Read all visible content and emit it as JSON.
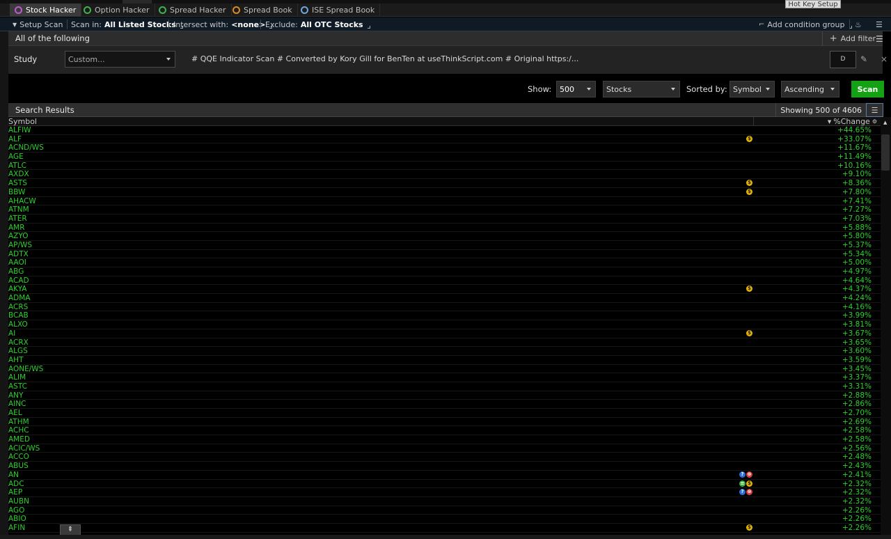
{
  "tabs": [
    {
      "label": "Stock Hacker",
      "icon": "stock-hacker-icon",
      "color": "#c05ad0",
      "active": true
    },
    {
      "label": "Option Hacker",
      "icon": "option-hacker-icon",
      "color": "#3fb34f"
    },
    {
      "label": "Spread Hacker",
      "icon": "spread-hacker-icon",
      "color": "#3fb34f"
    },
    {
      "label": "Spread Book",
      "icon": "spread-book-icon",
      "color": "#d98b25"
    },
    {
      "label": "ISE Spread Book",
      "icon": "ise-book-icon",
      "color": "#6fa6e0"
    }
  ],
  "hotkey_tooltip": "Hot Key Setup",
  "setup": {
    "setup_scan": "Setup Scan",
    "scan_in_label": "Scan in:",
    "scan_in_value": "All Listed Stocks",
    "intersect_label": "Intersect with:",
    "intersect_value": "<none>",
    "exclude_label": "Exclude:",
    "exclude_value": "All OTC Stocks",
    "add_condition_group": "Add condition group"
  },
  "filter": {
    "all_of_following": "All of the following",
    "add_filter": "Add filter"
  },
  "study": {
    "label": "Study",
    "select_value": "Custom...",
    "formula": "# QQE Indicator Scan # Converted by Kory Gill for BenTen at useThinkScript.com # Original https:/...",
    "aggregation": "D"
  },
  "controls": {
    "show_label": "Show:",
    "show_value": "500",
    "type_value": "Stocks",
    "sorted_by_label": "Sorted by:",
    "sort_field": "Symbol",
    "sort_order": "Ascending",
    "scan_button": "Scan"
  },
  "results": {
    "title": "Search Results",
    "showing": "Showing 500 of 4606",
    "col_symbol": "Symbol",
    "col_change": "%Change"
  },
  "rows": [
    {
      "symbol": "ALFIW",
      "change": "+44.65%",
      "icons": []
    },
    {
      "symbol": "ALF",
      "change": "+33.07%",
      "icons": [
        "earn"
      ]
    },
    {
      "symbol": "ACND/WS",
      "change": "+11.67%",
      "icons": []
    },
    {
      "symbol": "AGE",
      "change": "+11.49%",
      "icons": []
    },
    {
      "symbol": "ATLC",
      "change": "+10.16%",
      "icons": []
    },
    {
      "symbol": "AXDX",
      "change": "+9.10%",
      "icons": []
    },
    {
      "symbol": "ASTS",
      "change": "+8.36%",
      "icons": [
        "earn"
      ]
    },
    {
      "symbol": "BBW",
      "change": "+7.80%",
      "icons": [
        "earn"
      ]
    },
    {
      "symbol": "AHACW",
      "change": "+7.41%",
      "icons": []
    },
    {
      "symbol": "ATNM",
      "change": "+7.27%",
      "icons": []
    },
    {
      "symbol": "ATER",
      "change": "+7.03%",
      "icons": []
    },
    {
      "symbol": "AMR",
      "change": "+5.88%",
      "icons": []
    },
    {
      "symbol": "AZYO",
      "change": "+5.80%",
      "icons": []
    },
    {
      "symbol": "AP/WS",
      "change": "+5.37%",
      "icons": []
    },
    {
      "symbol": "ADTX",
      "change": "+5.34%",
      "icons": []
    },
    {
      "symbol": "AAOI",
      "change": "+5.00%",
      "icons": []
    },
    {
      "symbol": "ABG",
      "change": "+4.97%",
      "icons": []
    },
    {
      "symbol": "ACAD",
      "change": "+4.64%",
      "icons": []
    },
    {
      "symbol": "AKYA",
      "change": "+4.37%",
      "icons": [
        "earn"
      ]
    },
    {
      "symbol": "ADMA",
      "change": "+4.24%",
      "icons": []
    },
    {
      "symbol": "ACRS",
      "change": "+4.16%",
      "icons": []
    },
    {
      "symbol": "BCAB",
      "change": "+3.99%",
      "icons": []
    },
    {
      "symbol": "ALXO",
      "change": "+3.81%",
      "icons": []
    },
    {
      "symbol": "AI",
      "change": "+3.67%",
      "icons": [
        "earn"
      ]
    },
    {
      "symbol": "ACRX",
      "change": "+3.65%",
      "icons": []
    },
    {
      "symbol": "ALGS",
      "change": "+3.60%",
      "icons": []
    },
    {
      "symbol": "AHT",
      "change": "+3.59%",
      "icons": []
    },
    {
      "symbol": "AONE/WS",
      "change": "+3.45%",
      "icons": []
    },
    {
      "symbol": "ALIM",
      "change": "+3.37%",
      "icons": []
    },
    {
      "symbol": "ASTC",
      "change": "+3.31%",
      "icons": []
    },
    {
      "symbol": "ANY",
      "change": "+2.88%",
      "icons": []
    },
    {
      "symbol": "AINC",
      "change": "+2.86%",
      "icons": []
    },
    {
      "symbol": "AEL",
      "change": "+2.70%",
      "icons": []
    },
    {
      "symbol": "ATHM",
      "change": "+2.69%",
      "icons": []
    },
    {
      "symbol": "ACHC",
      "change": "+2.58%",
      "icons": []
    },
    {
      "symbol": "AMED",
      "change": "+2.58%",
      "icons": []
    },
    {
      "symbol": "ACIC/WS",
      "change": "+2.56%",
      "icons": []
    },
    {
      "symbol": "ACCO",
      "change": "+2.48%",
      "icons": []
    },
    {
      "symbol": "ABUS",
      "change": "+2.43%",
      "icons": []
    },
    {
      "symbol": "AN",
      "change": "+2.41%",
      "icons": [
        "news",
        "div"
      ]
    },
    {
      "symbol": "ADC",
      "change": "+2.32%",
      "icons": [
        "sent",
        "earn"
      ]
    },
    {
      "symbol": "AEP",
      "change": "+2.32%",
      "icons": [
        "news",
        "div"
      ]
    },
    {
      "symbol": "AUBN",
      "change": "+2.32%",
      "icons": []
    },
    {
      "symbol": "AGO",
      "change": "+2.26%",
      "icons": []
    },
    {
      "symbol": "ABIO",
      "change": "+2.26%",
      "icons": []
    },
    {
      "symbol": "AFIN",
      "change": "+2.26%",
      "icons": [
        "earn"
      ]
    }
  ]
}
